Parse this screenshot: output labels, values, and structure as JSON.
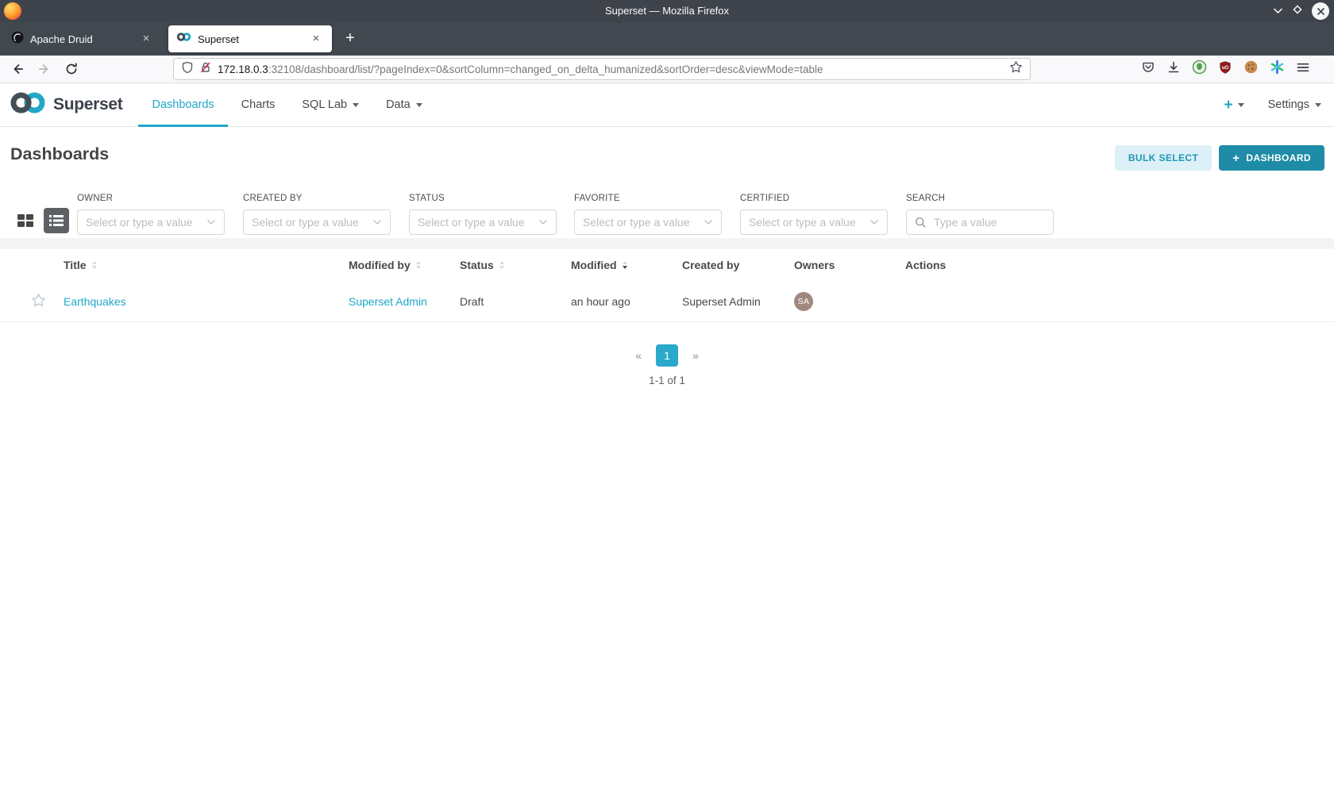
{
  "window": {
    "title": "Superset — Mozilla Firefox"
  },
  "browser": {
    "tabs": [
      {
        "label": "Apache Druid",
        "favicon": "druid-icon",
        "close": "×"
      },
      {
        "label": "Superset",
        "favicon": "superset-icon",
        "close": "×",
        "active": true
      }
    ],
    "new_tab": "+",
    "url": {
      "host": "172.18.0.3",
      "rest": ":32108/dashboard/list/?pageIndex=0&sortColumn=changed_on_delta_humanized&sortOrder=desc&viewMode=table"
    }
  },
  "nav": {
    "brand": "Superset",
    "items": [
      {
        "label": "Dashboards",
        "active": true
      },
      {
        "label": "Charts"
      },
      {
        "label": "SQL Lab",
        "has_caret": true
      },
      {
        "label": "Data",
        "has_caret": true
      }
    ],
    "add_label": "+",
    "settings_label": "Settings"
  },
  "header": {
    "title": "Dashboards",
    "bulk_select_label": "BULK SELECT",
    "plus": "+",
    "new_dashboard_label": "DASHBOARD"
  },
  "view_toggle": {
    "card_active": false,
    "list_active": true
  },
  "filters": {
    "owner": {
      "label": "OWNER",
      "placeholder": "Select or type a value"
    },
    "created_by": {
      "label": "CREATED BY",
      "placeholder": "Select or type a value"
    },
    "status": {
      "label": "STATUS",
      "placeholder": "Select or type a value"
    },
    "favorite": {
      "label": "FAVORITE",
      "placeholder": "Select or type a value"
    },
    "certified": {
      "label": "CERTIFIED",
      "placeholder": "Select or type a value"
    },
    "search": {
      "label": "SEARCH",
      "placeholder": "Type a value"
    }
  },
  "table": {
    "columns": [
      {
        "label": "Title",
        "sortable": true,
        "sorted": "none"
      },
      {
        "label": "Modified by",
        "sortable": true,
        "sorted": "none"
      },
      {
        "label": "Status",
        "sortable": true,
        "sorted": "none"
      },
      {
        "label": "Modified",
        "sortable": true,
        "sorted": "desc"
      },
      {
        "label": "Created by",
        "sortable": false
      },
      {
        "label": "Owners",
        "sortable": false
      },
      {
        "label": "Actions",
        "sortable": false
      }
    ],
    "rows": [
      {
        "title": "Earthquakes",
        "modified_by": "Superset Admin",
        "status": "Draft",
        "modified": "an hour ago",
        "created_by": "Superset Admin",
        "owner_initials": "SA"
      }
    ]
  },
  "pagination": {
    "prev": "«",
    "current_page": "1",
    "next": "»",
    "summary": "1-1 of 1"
  },
  "colors": {
    "primary": "#20A7C9",
    "primary_button": "#1E8CA7",
    "secondary_button_bg": "#DDF0F8",
    "pagination_active": "#2AA9CB",
    "avatar": "#A1887F",
    "titlebar": "#3F444C"
  }
}
